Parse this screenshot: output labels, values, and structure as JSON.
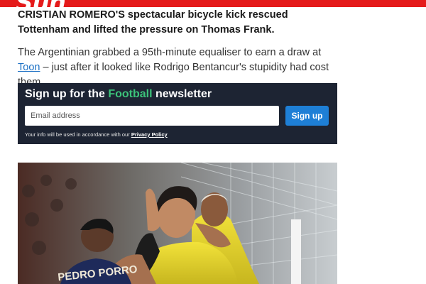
{
  "header": {
    "logo_text": "Sun",
    "brand_color": "#e51b1b"
  },
  "article": {
    "lede": "CRISTIAN ROMERO'S spectacular bicycle kick rescued Tottenham and lifted the pressure on Thomas Frank.",
    "para_before_link": "The Argentinian grabbed a 95th-minute equaliser to earn a draw at ",
    "para_link": "Toon",
    "para_after_link": " – just after it looked like Rodrigo Bentancur's stupidity had cost them."
  },
  "newsletter": {
    "title_prefix": "Sign up for the ",
    "title_accent": "Football",
    "title_suffix": " newsletter",
    "email_placeholder": "Email address",
    "signup_label": "Sign up",
    "note_text": "Your info will be used in accordance with our ",
    "privacy_link": "Privacy Policy",
    "panel_color": "#1d2433",
    "accent_color": "#3cc37a",
    "button_color": "#1e7fd6"
  },
  "photo": {
    "shirt_name": "PEDRO PORRO"
  }
}
